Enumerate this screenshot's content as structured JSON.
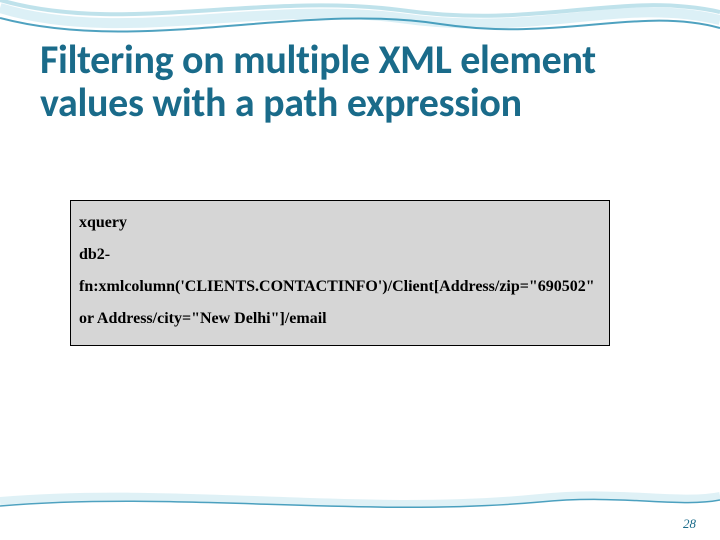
{
  "title": "Filtering on multiple XML element values with a path expression",
  "code": {
    "line1": "xquery",
    "line2": "db2-fn:xmlcolumn('CLIENTS.CONTACTINFO')/Client[Address/zip=\"690502\"",
    "line3": "or Address/city=\"New Delhi\"]/email"
  },
  "page_number": "28",
  "theme": {
    "accent": "#1a6b8a",
    "code_bg": "#d6d6d6",
    "wave_light": "#bfe4ee",
    "wave_dark": "#238bb0"
  }
}
